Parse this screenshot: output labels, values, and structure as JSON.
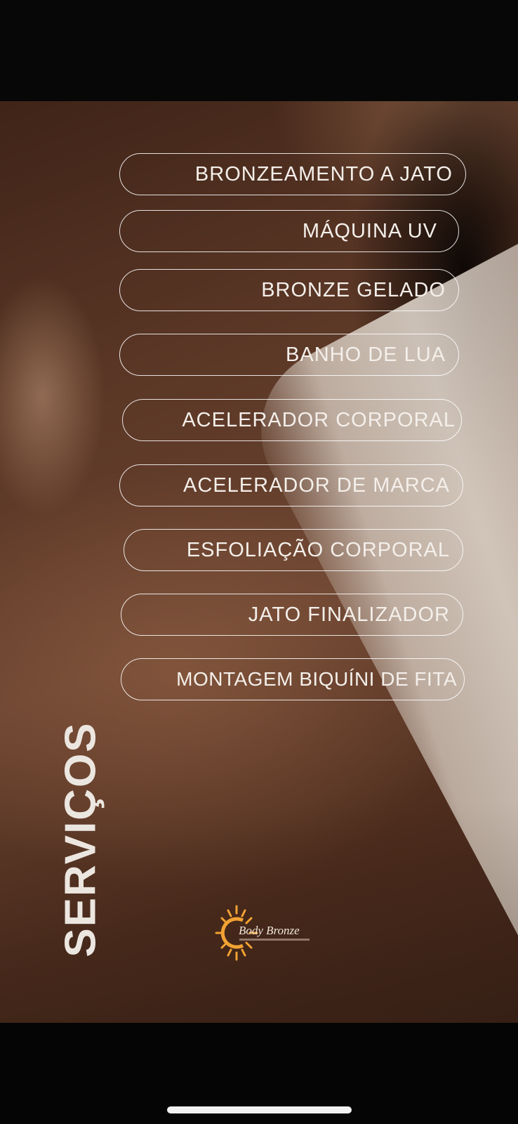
{
  "services": [
    "BRONZEAMENTO A JATO",
    "MÁQUINA UV",
    "BRONZE GELADO",
    "BANHO DE LUA",
    "ACELERADOR CORPORAL",
    "ACELERADOR DE MARCA",
    "ESFOLIAÇÃO CORPORAL",
    "JATO FINALIZADOR",
    "MONTAGEM BIQUÍNI DE FITA"
  ],
  "title": "SERVIÇOS",
  "logo": {
    "brand": "Body Bronze",
    "icon": "sun-icon"
  },
  "colors": {
    "accent": "#F2A233",
    "text": "#F4EFEA",
    "frame": "#050505"
  }
}
